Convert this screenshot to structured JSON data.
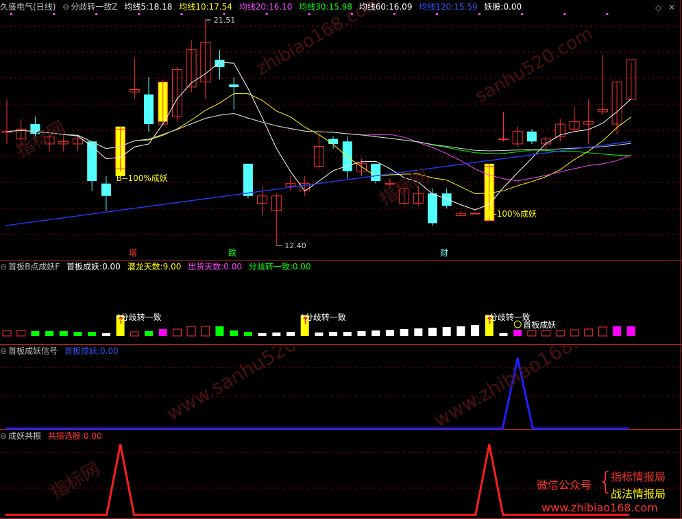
{
  "header_main": {
    "stock": "久盛电气",
    "period": "(日线)",
    "indicator": "分歧转一致Z",
    "ma5": {
      "label": "均线5:",
      "value": "18.18",
      "color": "#ffffff"
    },
    "ma10": {
      "label": "均线10:",
      "value": "17.54",
      "color": "#ffff00"
    },
    "ma20": {
      "label": "均线20:",
      "value": "16.10",
      "color": "#ff44ff"
    },
    "ma30": {
      "label": "均线30:",
      "value": "15.98",
      "color": "#00ff00"
    },
    "ma60": {
      "label": "均线60:",
      "value": "16.09",
      "color": "#ffffff"
    },
    "ma120": {
      "label": "均线120:",
      "value": "15.59",
      "color": "#3355ff"
    },
    "yao": {
      "label": "妖股:",
      "value": "0.00",
      "color": "#ffffff"
    }
  },
  "pane2_header": {
    "name": "首板B点成妖F",
    "a_label": "首板成妖:",
    "a_value": "0.00",
    "b_label": "潜龙天数:",
    "b_value": "9.00",
    "c_label": "出货天数:",
    "c_value": "0.00",
    "d_label": "分歧转一致:",
    "d_value": "0.00"
  },
  "pane3_header": {
    "name": "首板成妖信号",
    "a_label": "首板成妖:",
    "a_value": "0.00"
  },
  "pane4_header": {
    "name": "成妖共振",
    "a_label": "共振选股:",
    "a_value": "0.00"
  },
  "annotations": {
    "high": "21.51",
    "low": "12.40",
    "signal1": "B--100%成妖",
    "signal2": "B--100%成妖",
    "marker_zeng": "增",
    "marker_die": "跌",
    "marker_cai": "财",
    "fenqi1": "*分歧转一致",
    "fenqi2": "*分歧转一致",
    "fenqi3": "*分歧转一致",
    "shouban": "首板成妖"
  },
  "watermarks": [
    "指标网",
    "zhibiao168.com",
    "sanhu520.com",
    "指标网",
    "www.sanhu520.com",
    "www.zhibiao168.com",
    "指标网"
  ],
  "promo": {
    "wechat": "微信公众号",
    "brace": "{",
    "line1": "指标情报局",
    "line2": "战法情报局",
    "url": "www.zhibiao168.com"
  },
  "chart_data": {
    "type": "candlestick",
    "price_range": [
      12.4,
      21.51
    ],
    "candles": [
      {
        "o": 17.0,
        "h": 18.3,
        "l": 16.5,
        "c": 17.0
      },
      {
        "o": 16.7,
        "h": 17.5,
        "l": 16.4,
        "c": 17.1
      },
      {
        "o": 17.3,
        "h": 17.6,
        "l": 16.7,
        "c": 16.9
      },
      {
        "o": 16.5,
        "h": 16.9,
        "l": 16.2,
        "c": 16.8
      },
      {
        "o": 16.5,
        "h": 16.9,
        "l": 16.2,
        "c": 16.6
      },
      {
        "o": 16.5,
        "h": 16.8,
        "l": 16.2,
        "c": 16.7
      },
      {
        "o": 16.6,
        "h": 16.6,
        "l": 14.6,
        "c": 15.0
      },
      {
        "o": 14.9,
        "h": 15.2,
        "l": 13.8,
        "c": 14.4
      },
      {
        "o": 15.5,
        "h": 17.2,
        "l": 15.4,
        "c": 17.1
      },
      {
        "o": 18.6,
        "h": 20.0,
        "l": 18.3,
        "c": 18.7
      },
      {
        "o": 18.5,
        "h": 19.2,
        "l": 17.0,
        "c": 17.3
      },
      {
        "o": 17.3,
        "h": 19.1,
        "l": 17.3,
        "c": 19.0
      },
      {
        "o": 17.6,
        "h": 19.6,
        "l": 17.4,
        "c": 19.5
      },
      {
        "o": 18.8,
        "h": 20.7,
        "l": 18.6,
        "c": 20.3
      },
      {
        "o": 19.0,
        "h": 21.51,
        "l": 18.3,
        "c": 20.6
      },
      {
        "o": 19.9,
        "h": 20.3,
        "l": 19.1,
        "c": 19.6
      },
      {
        "o": 18.9,
        "h": 19.2,
        "l": 17.9,
        "c": 18.8
      },
      {
        "o": 15.7,
        "h": 15.7,
        "l": 14.3,
        "c": 14.4
      },
      {
        "o": 14.1,
        "h": 14.8,
        "l": 13.6,
        "c": 14.4
      },
      {
        "o": 13.8,
        "h": 14.5,
        "l": 12.4,
        "c": 14.4
      },
      {
        "o": 14.8,
        "h": 15.2,
        "l": 14.6,
        "c": 14.9
      },
      {
        "o": 14.6,
        "h": 15.2,
        "l": 14.4,
        "c": 14.9
      },
      {
        "o": 15.6,
        "h": 16.9,
        "l": 15.5,
        "c": 16.4
      },
      {
        "o": 16.7,
        "h": 16.8,
        "l": 16.3,
        "c": 16.5
      },
      {
        "o": 16.6,
        "h": 16.8,
        "l": 15.1,
        "c": 15.4
      },
      {
        "o": 15.4,
        "h": 15.9,
        "l": 15.2,
        "c": 15.7
      },
      {
        "o": 15.7,
        "h": 15.7,
        "l": 14.9,
        "c": 15.0
      },
      {
        "o": 14.9,
        "h": 15.1,
        "l": 14.7,
        "c": 14.9
      },
      {
        "o": 14.1,
        "h": 14.8,
        "l": 14.0,
        "c": 14.7
      },
      {
        "o": 14.1,
        "h": 14.8,
        "l": 14.0,
        "c": 14.5
      },
      {
        "o": 14.5,
        "h": 14.7,
        "l": 13.2,
        "c": 13.3
      },
      {
        "o": 14.5,
        "h": 14.7,
        "l": 13.9,
        "c": 14.0
      },
      {
        "o": 13.6,
        "h": 13.8,
        "l": 13.6,
        "c": 13.7
      },
      {
        "o": 13.7,
        "h": 13.7,
        "l": 13.7,
        "c": 13.7
      },
      {
        "o": 13.4,
        "h": 15.7,
        "l": 13.4,
        "c": 15.6
      },
      {
        "o": 16.7,
        "h": 17.8,
        "l": 16.6,
        "c": 16.7
      },
      {
        "o": 16.5,
        "h": 17.2,
        "l": 16.4,
        "c": 17.0
      },
      {
        "o": 17.0,
        "h": 17.1,
        "l": 16.5,
        "c": 16.6
      },
      {
        "o": 16.5,
        "h": 16.8,
        "l": 16.3,
        "c": 16.7
      },
      {
        "o": 16.8,
        "h": 17.5,
        "l": 16.6,
        "c": 17.3
      },
      {
        "o": 17.1,
        "h": 18.0,
        "l": 17.0,
        "c": 17.4
      },
      {
        "o": 17.3,
        "h": 18.3,
        "l": 16.5,
        "c": 17.4
      },
      {
        "o": 17.8,
        "h": 20.1,
        "l": 17.7,
        "c": 17.9
      },
      {
        "o": 17.3,
        "h": 19.0,
        "l": 16.9,
        "c": 19.0
      },
      {
        "o": 18.3,
        "h": 19.8,
        "l": 18.3,
        "c": 19.9
      }
    ],
    "signal_bars": [
      {
        "index": 8,
        "from": 15.2,
        "to": 17.2
      },
      {
        "index": 11,
        "from": 17.4,
        "to": 19.0
      },
      {
        "index": 34,
        "from": 13.4,
        "to": 15.7
      }
    ]
  },
  "colors": {
    "up": "#ff3232",
    "down": "#54ffff",
    "grid": "#8b0000",
    "axis": "#b22222",
    "signal": "#ffff00"
  }
}
